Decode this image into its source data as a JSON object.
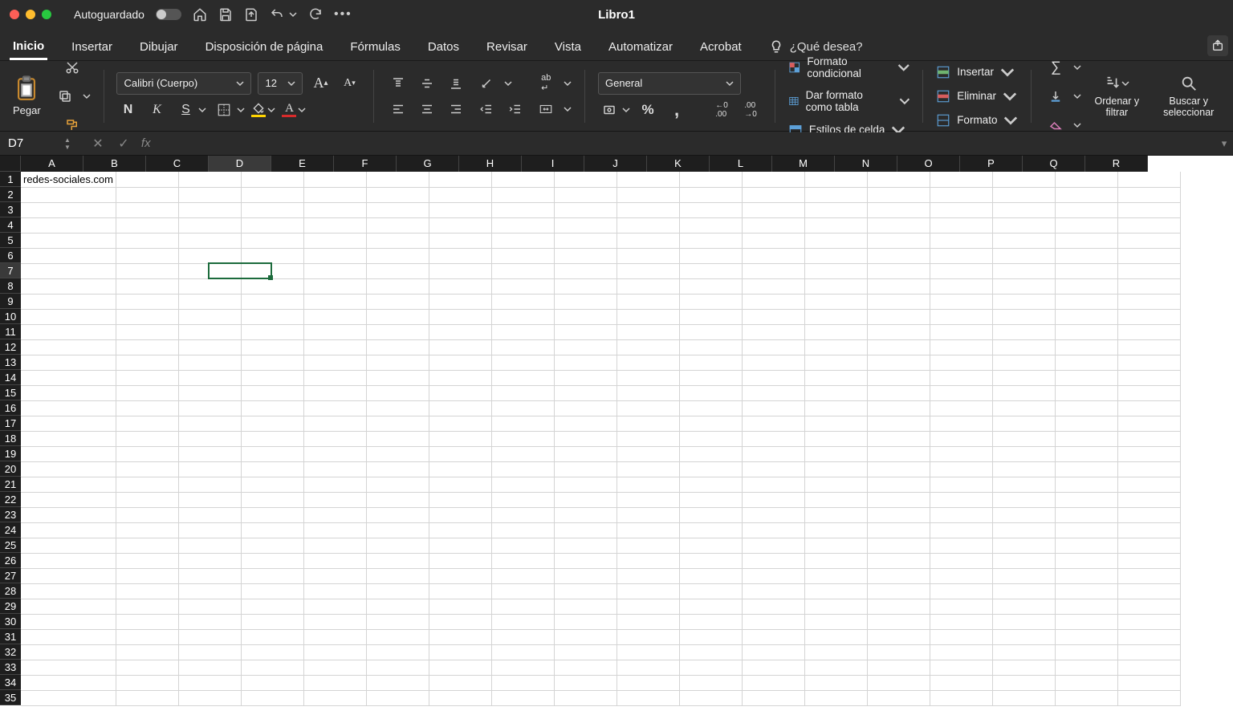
{
  "titlebar": {
    "autosave_label": "Autoguardado",
    "doc_title": "Libro1"
  },
  "tabs": {
    "inicio": "Inicio",
    "insertar": "Insertar",
    "dibujar": "Dibujar",
    "disposicion": "Disposición de página",
    "formulas": "Fórmulas",
    "datos": "Datos",
    "revisar": "Revisar",
    "vista": "Vista",
    "automatizar": "Automatizar",
    "acrobat": "Acrobat",
    "tell_me": "¿Qué desea?"
  },
  "ribbon": {
    "paste_label": "Pegar",
    "font_name": "Calibri (Cuerpo)",
    "font_size": "12",
    "bold": "N",
    "italic": "K",
    "underline": "S",
    "number_format": "General",
    "cond_format": "Formato condicional",
    "format_table": "Dar formato como tabla",
    "cell_styles": "Estilos de celda",
    "insertar": "Insertar",
    "eliminar": "Eliminar",
    "formato": "Formato",
    "sort_filter": "Ordenar y filtrar",
    "find_select": "Buscar y seleccionar"
  },
  "formula_bar": {
    "cell_ref": "D7",
    "formula": ""
  },
  "grid": {
    "columns": [
      "A",
      "B",
      "C",
      "D",
      "E",
      "F",
      "G",
      "H",
      "I",
      "J",
      "K",
      "L",
      "M",
      "N",
      "O",
      "P",
      "Q",
      "R"
    ],
    "row_count": 35,
    "selected_col_index": 3,
    "selected_row_index": 6,
    "cells": {
      "A1": "redes-sociales.com"
    }
  }
}
